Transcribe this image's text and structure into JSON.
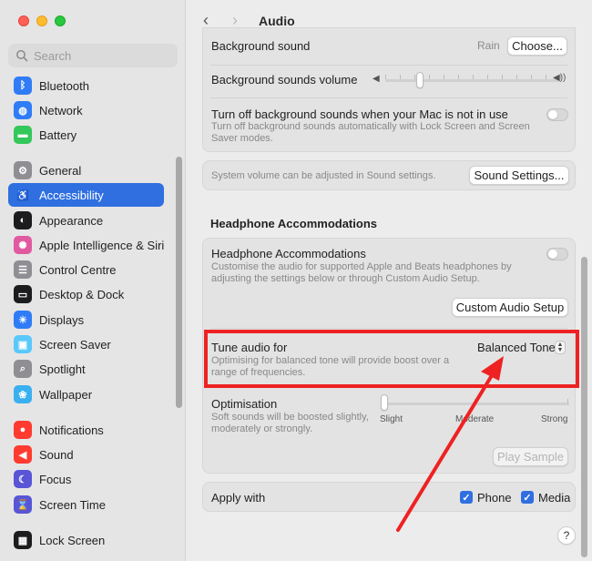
{
  "window": {
    "title": "Audio"
  },
  "sidebar": {
    "search_placeholder": "Search",
    "items": [
      {
        "label": "Bluetooth",
        "icon": "bluetooth-icon",
        "color": "#2f7cf6",
        "glyph": "ᛒ"
      },
      {
        "label": "Network",
        "icon": "globe-icon",
        "color": "#2f7cf6",
        "glyph": "◍"
      },
      {
        "label": "Battery",
        "icon": "battery-icon",
        "color": "#34c759",
        "glyph": "▬"
      },
      {
        "label": "General",
        "icon": "gear-icon",
        "color": "#8e8e93",
        "glyph": "⚙"
      },
      {
        "label": "Accessibility",
        "icon": "accessibility-icon",
        "color": "#2f6fe0",
        "glyph": "♿"
      },
      {
        "label": "Appearance",
        "icon": "appearance-icon",
        "color": "#1c1c1e",
        "glyph": "◐"
      },
      {
        "label": "Apple Intelligence & Siri",
        "icon": "siri-icon",
        "color": "#e05aa0",
        "glyph": "✺"
      },
      {
        "label": "Control Centre",
        "icon": "control-centre-icon",
        "color": "#8e8e93",
        "glyph": "☰"
      },
      {
        "label": "Desktop & Dock",
        "icon": "dock-icon",
        "color": "#1c1c1e",
        "glyph": "▭"
      },
      {
        "label": "Displays",
        "icon": "displays-icon",
        "color": "#2f7cf6",
        "glyph": "☀"
      },
      {
        "label": "Screen Saver",
        "icon": "screen-saver-icon",
        "color": "#5ac8fa",
        "glyph": "▣"
      },
      {
        "label": "Spotlight",
        "icon": "spotlight-icon",
        "color": "#8e8e93",
        "glyph": "⌕"
      },
      {
        "label": "Wallpaper",
        "icon": "wallpaper-icon",
        "color": "#3ab0f0",
        "glyph": "❀"
      },
      {
        "label": "Notifications",
        "icon": "notifications-icon",
        "color": "#ff3b30",
        "glyph": "●"
      },
      {
        "label": "Sound",
        "icon": "sound-icon",
        "color": "#ff3b30",
        "glyph": "◀"
      },
      {
        "label": "Focus",
        "icon": "focus-icon",
        "color": "#5856d6",
        "glyph": "☾"
      },
      {
        "label": "Screen Time",
        "icon": "screen-time-icon",
        "color": "#5856d6",
        "glyph": "⌛"
      },
      {
        "label": "Lock Screen",
        "icon": "lock-screen-icon",
        "color": "#1c1c1e",
        "glyph": "▦"
      }
    ],
    "active_index": 4
  },
  "main": {
    "background_sound": {
      "label": "Background sound",
      "value": "Rain",
      "button": "Choose..."
    },
    "bg_volume": {
      "label": "Background sounds volume",
      "level": 0.2
    },
    "turn_off": {
      "label": "Turn off background sounds when your Mac is not in use",
      "sub": "Turn off background sounds automatically with Lock Screen and Screen Saver modes."
    },
    "system_volume": {
      "text": "System volume can be adjusted in Sound settings.",
      "button": "Sound Settings..."
    },
    "section_title": "Headphone Accommodations",
    "headphone": {
      "label": "Headphone Accommodations",
      "sub": "Customise the audio for supported Apple and Beats headphones by adjusting the settings below or through Custom Audio Setup.",
      "button": "Custom Audio Setup"
    },
    "tune": {
      "label": "Tune audio for",
      "sub": "Optimising for balanced tone will provide boost over a range of frequencies.",
      "value": "Balanced Tone"
    },
    "optimisation": {
      "label": "Optimisation",
      "sub": "Soft sounds will be boosted slightly, moderately or strongly.",
      "levels": [
        "Slight",
        "Moderate",
        "Strong"
      ],
      "level": 0,
      "button": "Play Sample"
    },
    "apply": {
      "label": "Apply with",
      "phone": "Phone",
      "media": "Media"
    },
    "help": "?"
  },
  "colors": {
    "accent": "#2f6fe0",
    "highlight": "#ee2222"
  }
}
